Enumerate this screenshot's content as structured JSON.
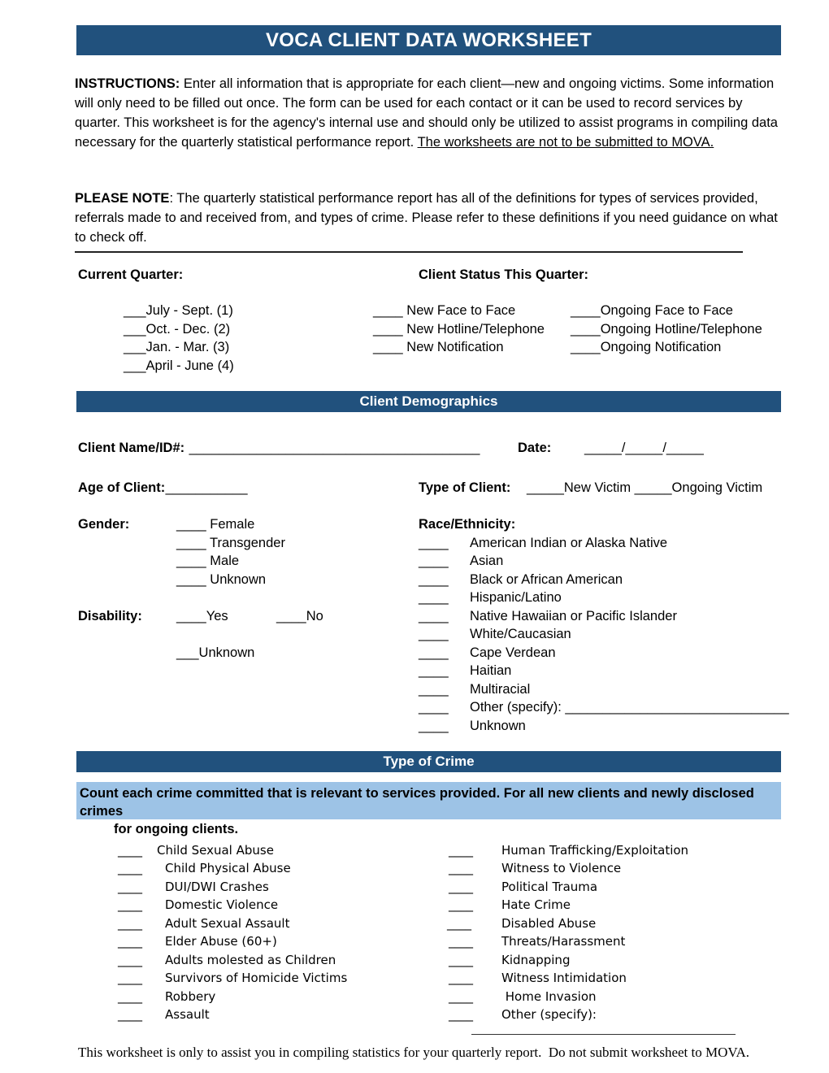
{
  "document": {
    "title": "VOCA CLIENT DATA WORKSHEET",
    "accent_color": "#21517D",
    "band_color": "#9DC3E6"
  },
  "instructions": {
    "label": "INSTRUCTIONS:",
    "body_1": " Enter all information that is appropriate for each client—new and ongoing victims. Some information will only need to be filled out once. The form can be used for each contact or it can be used to record services by quarter.  This worksheet is for the agency's internal use and should only be utilized to assist programs in compiling data necessary for the quarterly statistical performance report.  ",
    "body_underlined": "The worksheets are not to be submitted to MOVA."
  },
  "please_note": {
    "label": "PLEASE NOTE",
    "body": ": The quarterly statistical performance report has all of the definitions for types of services provided, referrals made to and received from, and types of crime. Please refer to these definitions if you need guidance on what to check off."
  },
  "quarter_section": {
    "current_quarter_label": "Current Quarter:",
    "client_status_label": "Client Status This Quarter:",
    "quarters": [
      "___July - Sept. (1)",
      "___Oct. - Dec. (2)",
      "___Jan. - Mar. (3)",
      "___April - June (4)"
    ],
    "new_status": [
      "____ New Face to Face",
      "____ New Hotline/Telephone",
      "____ New Notification"
    ],
    "ongoing_status": [
      "____Ongoing Face to Face",
      "____Ongoing Hotline/Telephone",
      "____Ongoing Notification"
    ]
  },
  "demographics": {
    "header": "Client Demographics",
    "client_name_label": "Client Name/ID#:",
    "client_name_line": " _______________________________________",
    "date_label": "Date:",
    "date_line": "_____/_____/_____",
    "age_label": "Age of Client:",
    "age_line": " ___________",
    "type_of_client_label": "Type of Client:",
    "type_of_client_options": "_____New Victim _____Ongoing Victim",
    "gender_label": "Gender:",
    "gender_options": [
      "____ Female",
      "____ Transgender",
      "____ Male",
      "____ Unknown"
    ],
    "disability_label": "Disability:",
    "disability_yes": "____Yes",
    "disability_no": "____No",
    "disability_unknown": "___Unknown",
    "race_label": "Race/Ethnicity:",
    "race_options": [
      "American Indian or Alaska Native",
      "Asian",
      "Black or African American",
      "Hispanic/Latino",
      "Native Hawaiian or Pacific Islander",
      "White/Caucasian",
      "Cape Verdean",
      "Haitian",
      "Multiracial",
      "Other (specify): ______________________________",
      "Unknown"
    ],
    "race_blank": "____"
  },
  "crime": {
    "header": "Type of Crime",
    "note_line_1": "Count each crime committed that is relevant to services provided. For all new clients and newly disclosed crimes",
    "note_line_2": "for ongoing clients.",
    "blank": "____",
    "left_column": [
      "Child Sexual Abuse",
      "Child Physical Abuse",
      "DUI/DWI Crashes",
      "Domestic Violence",
      "Adult Sexual Assault",
      "Elder Abuse (60+)",
      "Adults molested as Children",
      "Survivors of Homicide Victims",
      "Robbery",
      "Assault"
    ],
    "right_column": [
      "Human Trafficking/Exploitation",
      "Witness to Violence",
      "Political Trauma",
      "Hate Crime",
      "Disabled Abuse",
      "Threats/Harassment",
      "Kidnapping",
      "Witness Intimidation",
      " Home Invasion",
      "Other (specify):"
    ]
  },
  "footer": {
    "text": "This worksheet is only to assist you in compiling statistics for your quarterly report.  Do not submit worksheet to MOVA."
  }
}
